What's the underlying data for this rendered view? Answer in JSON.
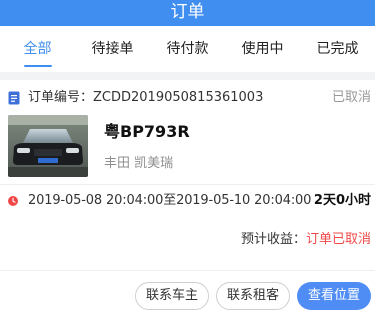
{
  "header": {
    "title": "订单"
  },
  "tabs": [
    {
      "label": "全部",
      "active": true
    },
    {
      "label": "待接单",
      "active": false
    },
    {
      "label": "待付款",
      "active": false
    },
    {
      "label": "使用中",
      "active": false
    },
    {
      "label": "已完成",
      "active": false
    }
  ],
  "order": {
    "number_label": "订单编号：ZCDD2019050815361003",
    "status": "已取消",
    "plate": "粤BP793R",
    "model": "丰田 凯美瑞",
    "time_range": "2019-05-08 20:04:00至2019-05-10 20:04:00",
    "duration": "2天0小时",
    "income_label": "预计收益：",
    "income_value": "订单已取消"
  },
  "actions": {
    "contact_owner": "联系车主",
    "contact_renter": "联系租客",
    "view_location": "查看位置"
  },
  "colors": {
    "accent": "#3f8ef0",
    "cancel_red": "#f04848",
    "primary_button": "#4f8df5"
  },
  "icons": {
    "order": "document-icon",
    "time": "clock-icon"
  }
}
